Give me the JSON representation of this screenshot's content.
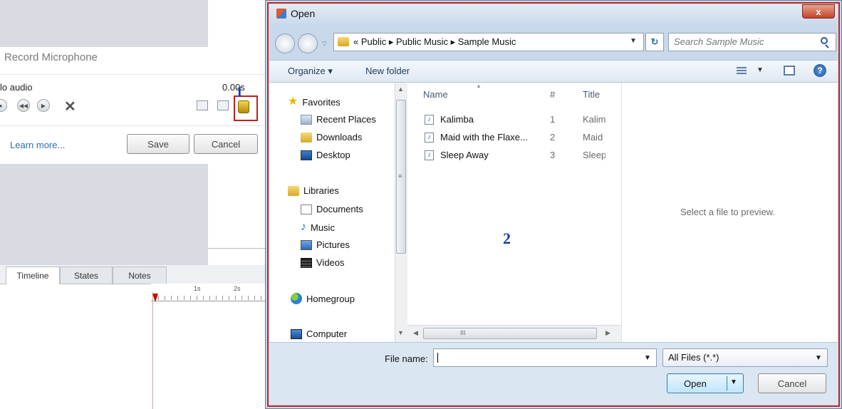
{
  "background_app": {
    "panel_title": "Record Microphone",
    "audio_status": "lo audio",
    "elapsed_time": "0.00s",
    "annotation_1": "1",
    "learn_more": "Learn more...",
    "save_label": "Save",
    "cancel_label": "Cancel",
    "tabs": [
      {
        "label": "Timeline",
        "active": true
      },
      {
        "label": "States",
        "active": false
      },
      {
        "label": "Notes",
        "active": false
      }
    ],
    "ruler_labels": [
      "1s",
      "2s"
    ]
  },
  "dialog": {
    "title": "Open",
    "close_label": "x",
    "address": "« Public ▸ Public Music ▸ Sample Music",
    "search_placeholder": "Search Sample Music",
    "toolbar": {
      "organize": "Organize ▾",
      "new_folder": "New folder",
      "help": "?"
    },
    "nav_pane": {
      "favorites": {
        "label": "Favorites",
        "items": [
          "Recent Places",
          "Downloads",
          "Desktop"
        ]
      },
      "libraries": {
        "label": "Libraries",
        "items": [
          "Documents",
          "Music",
          "Pictures",
          "Videos"
        ]
      },
      "homegroup": "Homegroup",
      "computer": "Computer"
    },
    "columns": {
      "name": "Name",
      "number": "#",
      "title": "Title"
    },
    "files": [
      {
        "name": "Kalimba",
        "number": "1",
        "title": "Kalimb"
      },
      {
        "name": "Maid with the Flaxe...",
        "number": "2",
        "title": "Maid w"
      },
      {
        "name": "Sleep Away",
        "number": "3",
        "title": "Sleep A"
      }
    ],
    "scroll_grip": "III",
    "annotation_2": "2",
    "preview_text": "Select a file to preview.",
    "file_name_label": "File name:",
    "file_name_value": "",
    "file_type": "All Files (*.*)",
    "open_label": "Open",
    "cancel_label": "Cancel"
  }
}
